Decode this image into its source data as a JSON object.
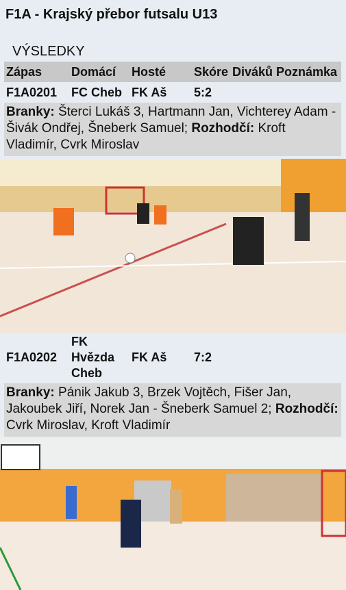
{
  "page": {
    "title": "F1A - Krajský přebor futsalu U13",
    "section": "VÝSLEDKY"
  },
  "table": {
    "headers": [
      "Zápas",
      "Domácí",
      "Hosté",
      "Skóre",
      "Diváků",
      "Poznámka"
    ]
  },
  "matches": [
    {
      "id": "F1A0201",
      "home": "FC Cheb",
      "away": "FK Aš",
      "score": "5:2",
      "goals_label": "Branky:",
      "goals": "Šterci Lukáš 3, Hartmann Jan, Vichterey Adam - Šivák Ondřej, Šneberk Samuel;",
      "referee_label": "Rozhodčí:",
      "referees": "Kroft Vladimír, Cvrk Miroslav"
    },
    {
      "id": "F1A0202",
      "home_lines": [
        "FK",
        "Hvězda",
        "Cheb"
      ],
      "away": "FK Aš",
      "score": "7:2",
      "goals_label": "Branky:",
      "goals": "Pánik Jakub 3, Brzek Vojtěch, Fišer Jan, Jakoubek Jiří, Norek Jan - Šneberk Samuel 2;",
      "referee_label": "Rozhodčí:",
      "referees": "Cvrk Miroslav, Kroft Vladimír"
    }
  ]
}
